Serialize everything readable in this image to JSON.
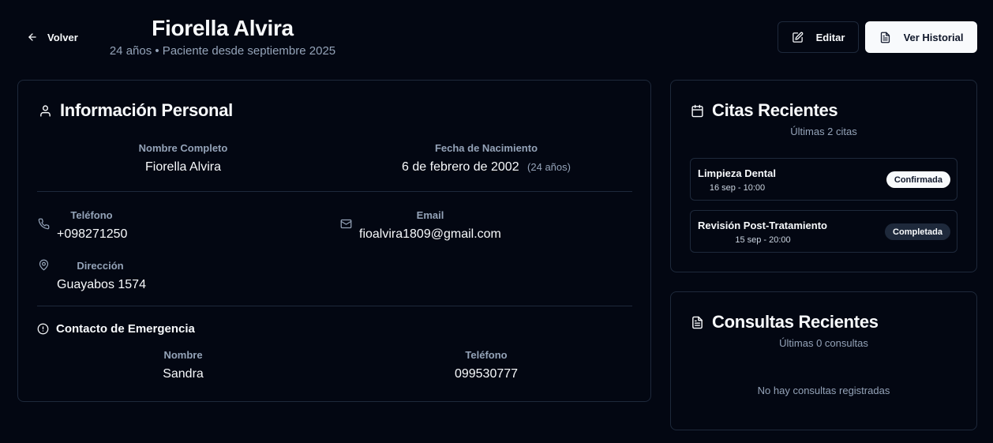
{
  "header": {
    "back_label": "Volver",
    "patient_name": "Fiorella Alvira",
    "subtitle": "24 años • Paciente desde septiembre 2025",
    "edit_label": "Editar",
    "history_label": "Ver Historial"
  },
  "personal_info": {
    "title": "Información Personal",
    "full_name_label": "Nombre Completo",
    "full_name": "Fiorella Alvira",
    "birth_label": "Fecha de Nacimiento",
    "birth_date": "6 de febrero de 2002",
    "age_note": "(24 años)",
    "phone_label": "Teléfono",
    "phone": "+098271250",
    "email_label": "Email",
    "email": "fioalvira1809@gmail.com",
    "address_label": "Dirección",
    "address": "Guayabos 1574",
    "emergency": {
      "title": "Contacto de Emergencia",
      "name_label": "Nombre",
      "name": "Sandra",
      "phone_label": "Teléfono",
      "phone": "099530777"
    }
  },
  "appointments": {
    "title": "Citas Recientes",
    "subtitle": "Últimas 2 citas",
    "items": [
      {
        "name": "Limpieza Dental",
        "time": "16 sep - 10:00",
        "status": "Confirmada"
      },
      {
        "name": "Revisión Post-Tratamiento",
        "time": "15 sep - 20:00",
        "status": "Completada"
      }
    ]
  },
  "consultations": {
    "title": "Consultas Recientes",
    "subtitle": "Últimas 0 consultas",
    "empty_text": "No hay consultas registradas"
  },
  "colors": {
    "background": "#030712",
    "border": "#1e293b",
    "muted_text": "#94a3b8",
    "primary_text": "#f8fafc"
  }
}
